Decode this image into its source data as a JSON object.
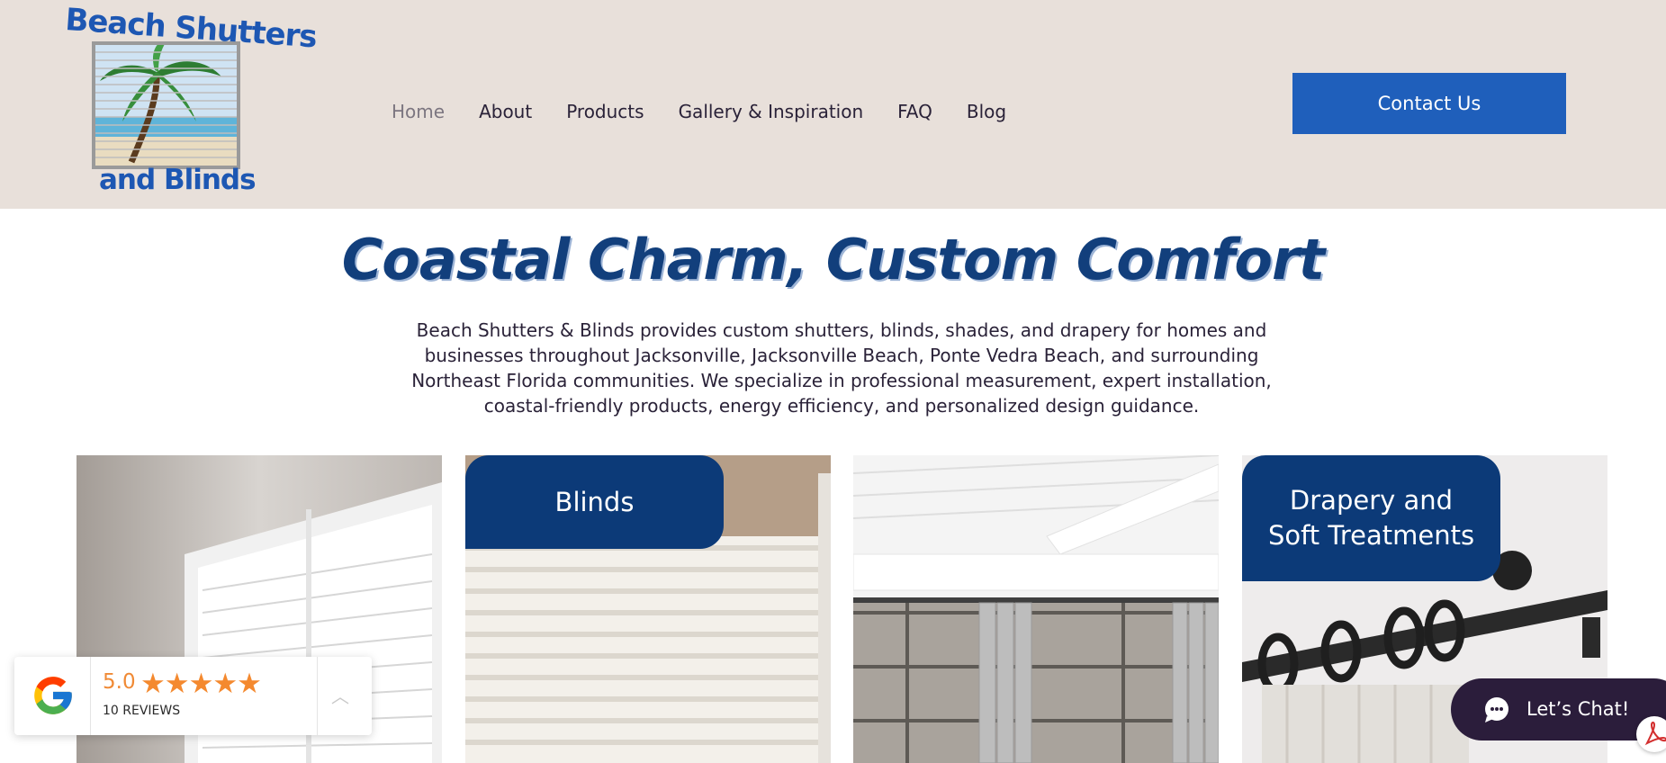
{
  "logo": {
    "line1": "Beach Shutters",
    "line2": "and Blinds"
  },
  "nav": {
    "items": [
      {
        "label": "Home",
        "active": true
      },
      {
        "label": "About"
      },
      {
        "label": "Products"
      },
      {
        "label": "Gallery & Inspiration"
      },
      {
        "label": "FAQ"
      },
      {
        "label": "Blog"
      }
    ]
  },
  "header": {
    "contact_label": "Contact Us",
    "background": "#e8e0da",
    "accent": "#1f5fbb"
  },
  "hero": {
    "title": "Coastal Charm, Custom Comfort",
    "text": "Beach Shutters & Blinds provides custom shutters, blinds, shades, and drapery for homes and businesses throughout Jacksonville, Jacksonville Beach, Ponte Vedra Beach, and surrounding Northeast Florida communities. We specialize in professional measurement, expert installation, coastal-friendly products, energy efficiency, and personalized design guidance."
  },
  "cards": [
    {
      "label": ""
    },
    {
      "label": "Blinds"
    },
    {
      "label": ""
    },
    {
      "label": "Drapery and Soft Treatments"
    }
  ],
  "reviews": {
    "score": "5.0",
    "stars": "★★★★★",
    "count": "10 REVIEWS",
    "icon": "google-icon"
  },
  "chat": {
    "label": "Let’s Chat!",
    "icon": "chat-bubble-icon"
  },
  "pdf": {
    "icon": "pdf-icon"
  }
}
